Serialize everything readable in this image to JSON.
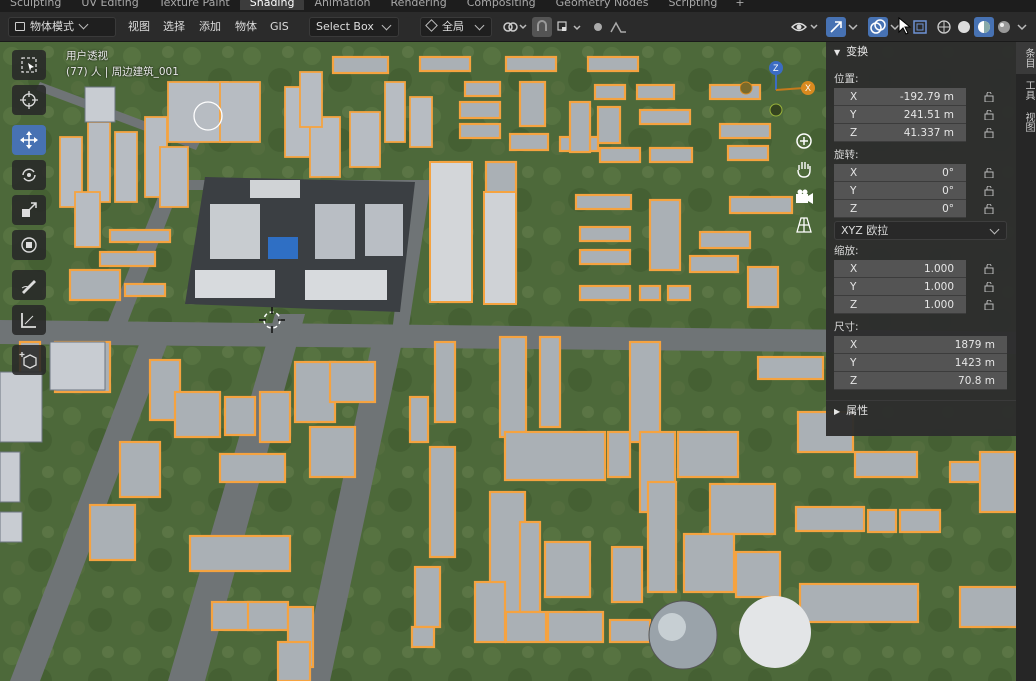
{
  "workspace_tabs": [
    "Sculpting",
    "UV Editing",
    "Texture Paint",
    "Shading",
    "Animation",
    "Rendering",
    "Compositing",
    "Geometry Nodes",
    "Scripting"
  ],
  "active_tab": "Shading",
  "header": {
    "mode": "物体模式",
    "menu_view": "视图",
    "menu_select": "选择",
    "menu_add": "添加",
    "menu_object": "物体",
    "menu_gis": "GIS",
    "select_box": "Select Box",
    "transform_orientation": "全局"
  },
  "viewport": {
    "perspective": "用户透视",
    "object_info": "(77) 人 | 周边建筑_001"
  },
  "npanel": {
    "transform_title": "变换",
    "location_label": "位置:",
    "location": [
      {
        "axis": "X",
        "value": "-192.79 m"
      },
      {
        "axis": "Y",
        "value": "241.51 m"
      },
      {
        "axis": "Z",
        "value": "41.337 m"
      }
    ],
    "rotation_label": "旋转:",
    "rotation": [
      {
        "axis": "X",
        "value": "0°"
      },
      {
        "axis": "Y",
        "value": "0°"
      },
      {
        "axis": "Z",
        "value": "0°"
      }
    ],
    "rotation_mode": "XYZ 欧拉",
    "scale_label": "缩放:",
    "scale": [
      {
        "axis": "X",
        "value": "1.000"
      },
      {
        "axis": "Y",
        "value": "1.000"
      },
      {
        "axis": "Z",
        "value": "1.000"
      }
    ],
    "dimensions_label": "尺寸:",
    "dimensions": [
      {
        "axis": "X",
        "value": "1879 m"
      },
      {
        "axis": "Y",
        "value": "1423 m"
      },
      {
        "axis": "Z",
        "value": "70.8 m"
      }
    ],
    "properties_title": "属性",
    "side_tabs": [
      "条目",
      "工具",
      "视图"
    ]
  },
  "colors": {
    "accent": "#4772b3",
    "selection": "#f5a340",
    "terrain": "#4e6a3a"
  }
}
